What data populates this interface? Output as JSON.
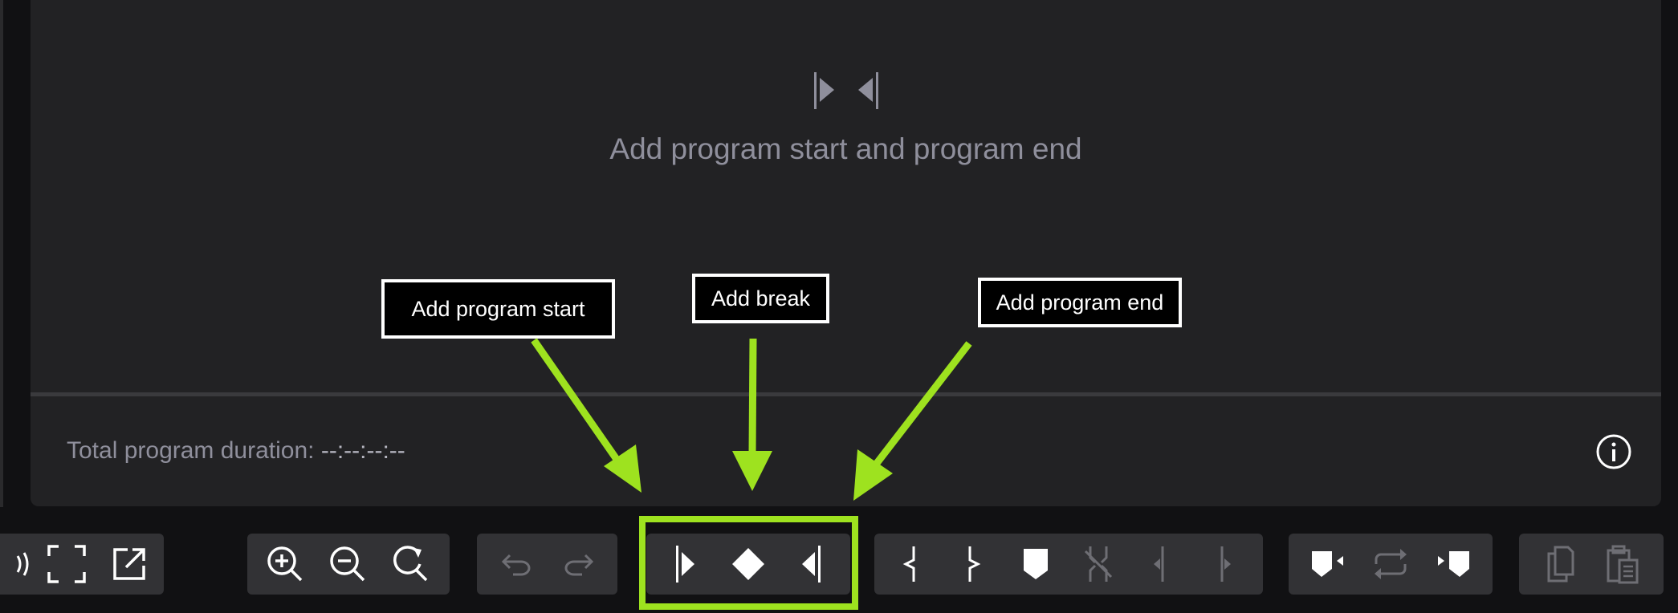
{
  "empty_state": {
    "message": "Add program start and program end"
  },
  "footer": {
    "duration_label": "Total program duration:",
    "duration_value": "--:--:--:--"
  },
  "callouts": {
    "start": "Add program start",
    "break": "Add break",
    "end": "Add program end"
  },
  "toolbar": {
    "view_group": [
      "volume-icon",
      "fullscreen-icon",
      "external-window-icon"
    ],
    "zoom_group": [
      "zoom-in-icon",
      "zoom-out-icon",
      "zoom-reset-icon"
    ],
    "history_group": [
      "undo-icon",
      "redo-icon"
    ],
    "program_group": [
      "program-start-icon",
      "break-icon",
      "program-end-icon"
    ],
    "segment_group": [
      "segment-start-icon",
      "segment-end-icon",
      "marker-icon",
      "split-icon",
      "nudge-left-icon",
      "nudge-right-icon"
    ],
    "loop_group": [
      "marker-prev-icon",
      "loop-icon",
      "marker-next-icon"
    ],
    "clipboard_group": [
      "copy-icon",
      "paste-icon"
    ]
  },
  "colors": {
    "highlight": "#9ee21f",
    "panel": "#222224",
    "toolbar": "#323235",
    "text_muted": "#8f8f9c",
    "icon_white": "#ffffff",
    "icon_disabled": "#6e6e74"
  }
}
